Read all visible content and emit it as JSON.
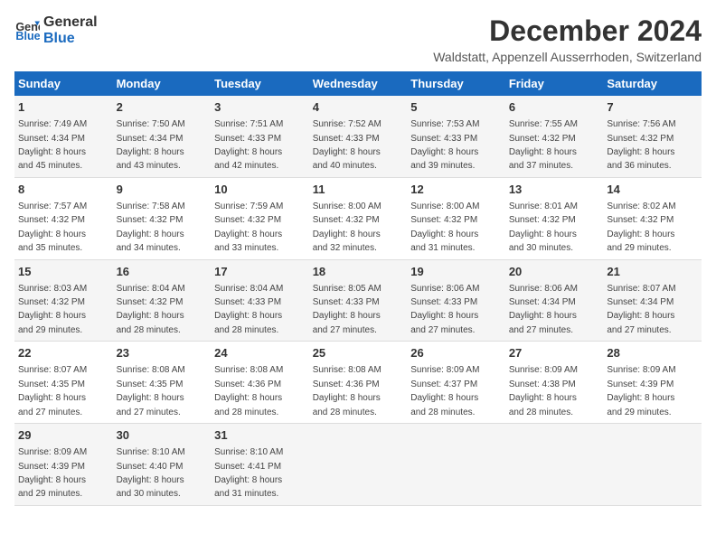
{
  "logo": {
    "general": "General",
    "blue": "Blue"
  },
  "title": "December 2024",
  "subtitle": "Waldstatt, Appenzell Ausserrhoden, Switzerland",
  "days_of_week": [
    "Sunday",
    "Monday",
    "Tuesday",
    "Wednesday",
    "Thursday",
    "Friday",
    "Saturday"
  ],
  "weeks": [
    [
      {
        "day": "1",
        "sunrise": "7:49 AM",
        "sunset": "4:34 PM",
        "daylight_hours": "8",
        "daylight_minutes": "45"
      },
      {
        "day": "2",
        "sunrise": "7:50 AM",
        "sunset": "4:34 PM",
        "daylight_hours": "8",
        "daylight_minutes": "43"
      },
      {
        "day": "3",
        "sunrise": "7:51 AM",
        "sunset": "4:33 PM",
        "daylight_hours": "8",
        "daylight_minutes": "42"
      },
      {
        "day": "4",
        "sunrise": "7:52 AM",
        "sunset": "4:33 PM",
        "daylight_hours": "8",
        "daylight_minutes": "40"
      },
      {
        "day": "5",
        "sunrise": "7:53 AM",
        "sunset": "4:33 PM",
        "daylight_hours": "8",
        "daylight_minutes": "39"
      },
      {
        "day": "6",
        "sunrise": "7:55 AM",
        "sunset": "4:32 PM",
        "daylight_hours": "8",
        "daylight_minutes": "37"
      },
      {
        "day": "7",
        "sunrise": "7:56 AM",
        "sunset": "4:32 PM",
        "daylight_hours": "8",
        "daylight_minutes": "36"
      }
    ],
    [
      {
        "day": "8",
        "sunrise": "7:57 AM",
        "sunset": "4:32 PM",
        "daylight_hours": "8",
        "daylight_minutes": "35"
      },
      {
        "day": "9",
        "sunrise": "7:58 AM",
        "sunset": "4:32 PM",
        "daylight_hours": "8",
        "daylight_minutes": "34"
      },
      {
        "day": "10",
        "sunrise": "7:59 AM",
        "sunset": "4:32 PM",
        "daylight_hours": "8",
        "daylight_minutes": "33"
      },
      {
        "day": "11",
        "sunrise": "8:00 AM",
        "sunset": "4:32 PM",
        "daylight_hours": "8",
        "daylight_minutes": "32"
      },
      {
        "day": "12",
        "sunrise": "8:00 AM",
        "sunset": "4:32 PM",
        "daylight_hours": "8",
        "daylight_minutes": "31"
      },
      {
        "day": "13",
        "sunrise": "8:01 AM",
        "sunset": "4:32 PM",
        "daylight_hours": "8",
        "daylight_minutes": "30"
      },
      {
        "day": "14",
        "sunrise": "8:02 AM",
        "sunset": "4:32 PM",
        "daylight_hours": "8",
        "daylight_minutes": "29"
      }
    ],
    [
      {
        "day": "15",
        "sunrise": "8:03 AM",
        "sunset": "4:32 PM",
        "daylight_hours": "8",
        "daylight_minutes": "29"
      },
      {
        "day": "16",
        "sunrise": "8:04 AM",
        "sunset": "4:32 PM",
        "daylight_hours": "8",
        "daylight_minutes": "28"
      },
      {
        "day": "17",
        "sunrise": "8:04 AM",
        "sunset": "4:33 PM",
        "daylight_hours": "8",
        "daylight_minutes": "28"
      },
      {
        "day": "18",
        "sunrise": "8:05 AM",
        "sunset": "4:33 PM",
        "daylight_hours": "8",
        "daylight_minutes": "27"
      },
      {
        "day": "19",
        "sunrise": "8:06 AM",
        "sunset": "4:33 PM",
        "daylight_hours": "8",
        "daylight_minutes": "27"
      },
      {
        "day": "20",
        "sunrise": "8:06 AM",
        "sunset": "4:34 PM",
        "daylight_hours": "8",
        "daylight_minutes": "27"
      },
      {
        "day": "21",
        "sunrise": "8:07 AM",
        "sunset": "4:34 PM",
        "daylight_hours": "8",
        "daylight_minutes": "27"
      }
    ],
    [
      {
        "day": "22",
        "sunrise": "8:07 AM",
        "sunset": "4:35 PM",
        "daylight_hours": "8",
        "daylight_minutes": "27"
      },
      {
        "day": "23",
        "sunrise": "8:08 AM",
        "sunset": "4:35 PM",
        "daylight_hours": "8",
        "daylight_minutes": "27"
      },
      {
        "day": "24",
        "sunrise": "8:08 AM",
        "sunset": "4:36 PM",
        "daylight_hours": "8",
        "daylight_minutes": "28"
      },
      {
        "day": "25",
        "sunrise": "8:08 AM",
        "sunset": "4:36 PM",
        "daylight_hours": "8",
        "daylight_minutes": "28"
      },
      {
        "day": "26",
        "sunrise": "8:09 AM",
        "sunset": "4:37 PM",
        "daylight_hours": "8",
        "daylight_minutes": "28"
      },
      {
        "day": "27",
        "sunrise": "8:09 AM",
        "sunset": "4:38 PM",
        "daylight_hours": "8",
        "daylight_minutes": "28"
      },
      {
        "day": "28",
        "sunrise": "8:09 AM",
        "sunset": "4:39 PM",
        "daylight_hours": "8",
        "daylight_minutes": "29"
      }
    ],
    [
      {
        "day": "29",
        "sunrise": "8:09 AM",
        "sunset": "4:39 PM",
        "daylight_hours": "8",
        "daylight_minutes": "29"
      },
      {
        "day": "30",
        "sunrise": "8:10 AM",
        "sunset": "4:40 PM",
        "daylight_hours": "8",
        "daylight_minutes": "30"
      },
      {
        "day": "31",
        "sunrise": "8:10 AM",
        "sunset": "4:41 PM",
        "daylight_hours": "8",
        "daylight_minutes": "31"
      },
      {
        "day": "",
        "sunrise": "",
        "sunset": "",
        "daylight_hours": "",
        "daylight_minutes": ""
      },
      {
        "day": "",
        "sunrise": "",
        "sunset": "",
        "daylight_hours": "",
        "daylight_minutes": ""
      },
      {
        "day": "",
        "sunrise": "",
        "sunset": "",
        "daylight_hours": "",
        "daylight_minutes": ""
      },
      {
        "day": "",
        "sunrise": "",
        "sunset": "",
        "daylight_hours": "",
        "daylight_minutes": ""
      }
    ]
  ]
}
